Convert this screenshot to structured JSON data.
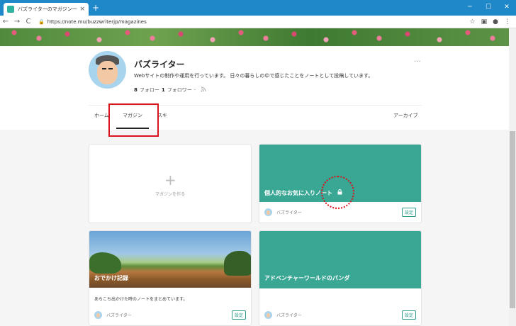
{
  "browser": {
    "tab_title": "バズライターのマガジン一覧｜note",
    "tab_close": "×",
    "new_tab": "+",
    "back": "←",
    "forward": "→",
    "reload": "C",
    "url": "https://note.mu/buzzwriterjp/magazines",
    "win_min": "─",
    "win_max": "☐",
    "win_close": "✕",
    "star_icon": "☆",
    "ext_icon": "▣",
    "account_icon": "●",
    "menu_icon": "⋮"
  },
  "profile": {
    "name": "バズライター",
    "more": "···",
    "bio": "Webサイトの制作や運用を行っています。 日々の暮らしの中で感じたことをノートとして投稿しています。",
    "follow_count": "8",
    "follow_label": "フォロー",
    "follower_count": "1",
    "follower_label": "フォロワー",
    "separator": "·",
    "rss_icon": "rss-icon"
  },
  "nav": {
    "home": "ホーム",
    "magazine": "マガジン",
    "like": "スキ",
    "archive": "アーカイブ"
  },
  "create_card": {
    "plus": "+",
    "label": "マガジンを作る"
  },
  "magazines": [
    {
      "title": "個人的なお気に入りノート",
      "lock_icon": "lock-icon",
      "author": "バズライター",
      "settings": "設定",
      "thumb_color": "#3aa694"
    },
    {
      "title": "おでかけ記録",
      "description": "あちこち出かけた時のノートをまとめています。",
      "author": "バズライター",
      "settings": "設定"
    },
    {
      "title": "アドベンチャーワールドのパンダ",
      "author": "バズライター",
      "settings": "設定",
      "thumb_color": "#3aa694"
    }
  ],
  "colors": {
    "titlebar": "#1e88c9",
    "accent": "#2a9d8a",
    "highlight": "#d8151c"
  }
}
